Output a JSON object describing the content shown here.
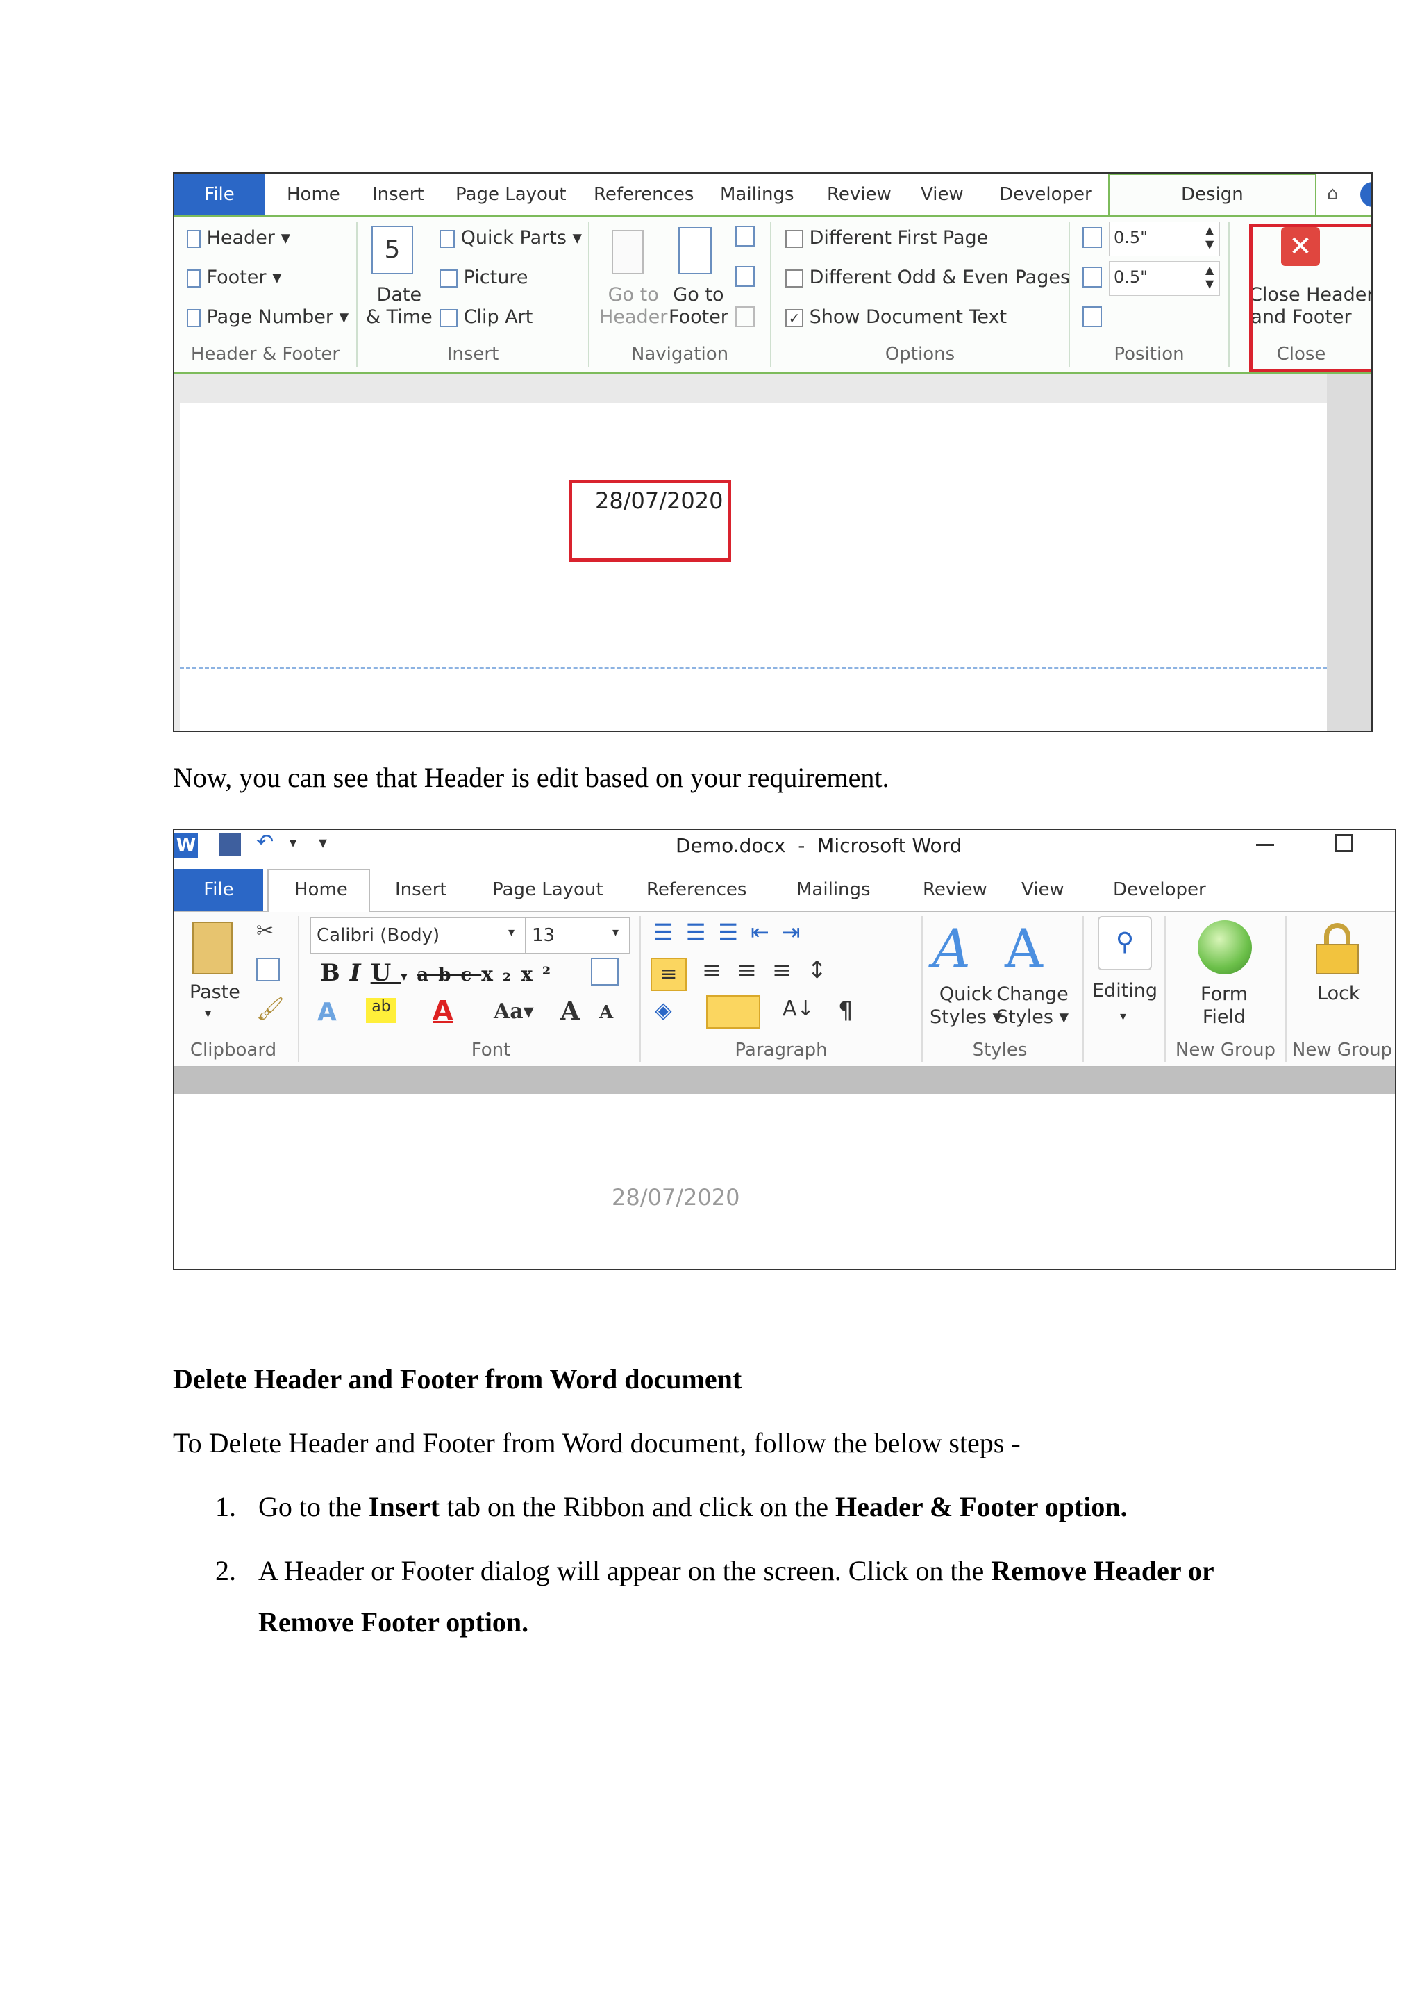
{
  "shot1": {
    "tabs": [
      "File",
      "Home",
      "Insert",
      "Page Layout",
      "References",
      "Mailings",
      "Review",
      "View",
      "Developer",
      "Design"
    ],
    "groups": {
      "header_footer": {
        "items": [
          "Header",
          "Footer",
          "Page Number"
        ],
        "label": "Header & Footer"
      },
      "insert": {
        "date_time": [
          "Date",
          "& Time"
        ],
        "items": [
          "Quick Parts",
          "Picture",
          "Clip Art"
        ],
        "label": "Insert"
      },
      "navigation": {
        "goto_header": [
          "Go to",
          "Header"
        ],
        "goto_footer": [
          "Go to",
          "Footer"
        ],
        "label": "Navigation"
      },
      "options": {
        "items": [
          "Different First Page",
          "Different Odd & Even Pages",
          "Show Document Text"
        ],
        "checked": [
          false,
          false,
          true
        ],
        "label": "Options"
      },
      "position": {
        "top": "0.5\"",
        "bottom": "0.5\"",
        "label": "Position"
      },
      "close": {
        "button": [
          "Close Header",
          "and Footer"
        ],
        "label": "Close"
      }
    },
    "header_text": "28/07/2020"
  },
  "caption1": "Now, you can see that Header is edit based on your requirement.",
  "shot2": {
    "window_title": "Demo.docx  -  Microsoft Word",
    "tabs": [
      "File",
      "Home",
      "Insert",
      "Page Layout",
      "References",
      "Mailings",
      "Review",
      "View",
      "Developer"
    ],
    "font_name": "Calibri (Body)",
    "font_size": "13",
    "paste_label": "Paste",
    "groups": [
      "Clipboard",
      "Font",
      "Paragraph",
      "Styles",
      "New Group",
      "New Group"
    ],
    "quick_styles": [
      "Quick",
      "Styles"
    ],
    "change_styles": [
      "Change",
      "Styles"
    ],
    "editing": "Editing",
    "form_field": [
      "Form",
      "Field"
    ],
    "lock": "Lock",
    "header_text": "28/07/2020"
  },
  "heading": "Delete Header and Footer from Word document",
  "intro": "To Delete Header and Footer from Word document, follow the below steps -",
  "steps": [
    {
      "num": "1.",
      "t1": "Go to the ",
      "b1": "Insert",
      "t2": " tab on the Ribbon and click on the ",
      "b2": "Header & Footer option."
    },
    {
      "num": "2.",
      "t1": "A Header or Footer dialog will appear on the screen. Click on the ",
      "b1": "Remove Header or",
      "b2": "Remove Footer option."
    }
  ]
}
